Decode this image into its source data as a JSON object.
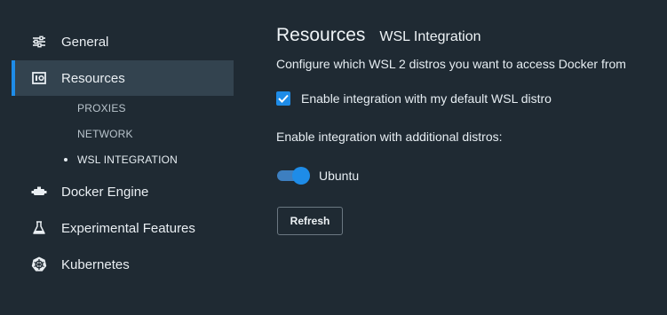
{
  "sidebar": {
    "items": [
      {
        "label": "General",
        "icon": "sliders-icon"
      },
      {
        "label": "Resources",
        "icon": "resources-icon",
        "active": true
      },
      {
        "label": "Docker Engine",
        "icon": "docker-engine-icon"
      },
      {
        "label": "Experimental Features",
        "icon": "flask-icon"
      },
      {
        "label": "Kubernetes",
        "icon": "kubernetes-icon"
      }
    ],
    "subitems": [
      {
        "label": "PROXIES"
      },
      {
        "label": "NETWORK"
      },
      {
        "label": "WSL INTEGRATION",
        "current": true
      }
    ]
  },
  "main": {
    "title": "Resources",
    "subtitle": "WSL Integration",
    "description": "Configure which WSL 2 distros you want to access Docker from",
    "default_checkbox": {
      "label": "Enable integration with my default WSL distro",
      "checked": true
    },
    "additional_label": "Enable integration with additional distros:",
    "distros": [
      {
        "label": "Ubuntu",
        "enabled": true
      }
    ],
    "refresh_label": "Refresh"
  },
  "colors": {
    "accent": "#1e8ce8",
    "background": "#1f2a33",
    "active_item": "#33434f"
  }
}
